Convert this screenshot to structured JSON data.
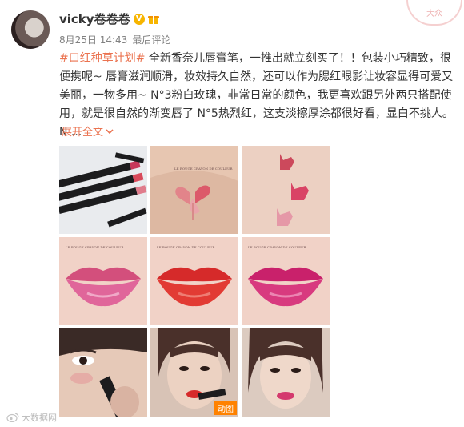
{
  "header": {
    "stamp": "大众",
    "username": "vicky卷卷卷",
    "badge_v": "V",
    "time": "8月25日 14:43",
    "source": "最后评论"
  },
  "post": {
    "topic": "#口红种草计划#",
    "body": " 全新香奈儿唇膏笔，一推出就立刻买了！！包装小巧精致，很便携呢~ 唇膏滋润顺滑，妆效持久自然，还可以作为腮红眼影让妆容显得可爱又美丽，一物多用~ N°3粉白玫瑰，非常日常的颜色，我更喜欢跟另外两只搭配使用，就是很自然的渐变唇了 N°5热烈红，这支淡擦厚涂都很好看，显白不挑人。 N ...",
    "expand_label": "展开全文",
    "expand_icon": "chevron-down-icon"
  },
  "images": [
    {
      "name": "photo-lipstick-pens"
    },
    {
      "name": "photo-heart-swatch"
    },
    {
      "name": "photo-cat-swatch"
    },
    {
      "name": "photo-lips-pink"
    },
    {
      "name": "photo-lips-red"
    },
    {
      "name": "photo-lips-fuchsia"
    },
    {
      "name": "photo-face-applying"
    },
    {
      "name": "photo-face-lipstick"
    },
    {
      "name": "photo-face-finished"
    }
  ],
  "gif_badge": "动图",
  "photo_text": "LE ROUGE CRAYON DE COULEUR",
  "watermark": "大数据网",
  "colors": {
    "accent": "#eb7350",
    "gif": "#ff8200",
    "verified": "#f7b500"
  }
}
